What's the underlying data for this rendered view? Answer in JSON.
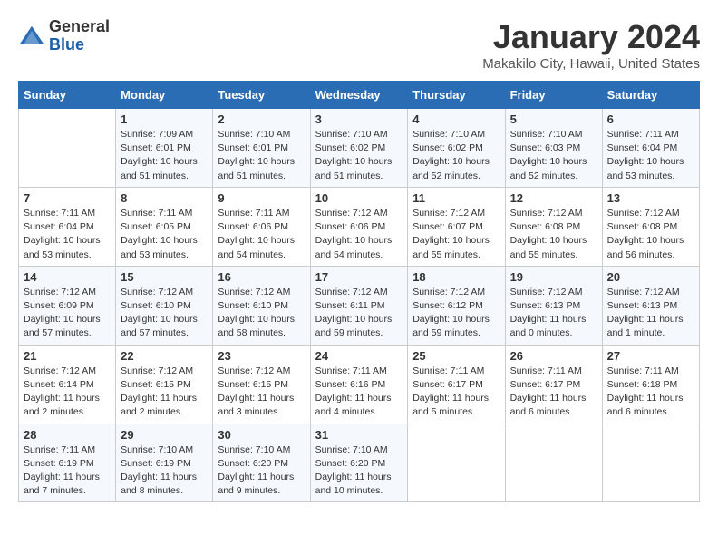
{
  "logo": {
    "general": "General",
    "blue": "Blue"
  },
  "title": "January 2024",
  "subtitle": "Makakilo City, Hawaii, United States",
  "weekdays": [
    "Sunday",
    "Monday",
    "Tuesday",
    "Wednesday",
    "Thursday",
    "Friday",
    "Saturday"
  ],
  "weeks": [
    [
      {
        "day": "",
        "sunrise": "",
        "sunset": "",
        "daylight": ""
      },
      {
        "day": "1",
        "sunrise": "Sunrise: 7:09 AM",
        "sunset": "Sunset: 6:01 PM",
        "daylight": "Daylight: 10 hours and 51 minutes."
      },
      {
        "day": "2",
        "sunrise": "Sunrise: 7:10 AM",
        "sunset": "Sunset: 6:01 PM",
        "daylight": "Daylight: 10 hours and 51 minutes."
      },
      {
        "day": "3",
        "sunrise": "Sunrise: 7:10 AM",
        "sunset": "Sunset: 6:02 PM",
        "daylight": "Daylight: 10 hours and 51 minutes."
      },
      {
        "day": "4",
        "sunrise": "Sunrise: 7:10 AM",
        "sunset": "Sunset: 6:02 PM",
        "daylight": "Daylight: 10 hours and 52 minutes."
      },
      {
        "day": "5",
        "sunrise": "Sunrise: 7:10 AM",
        "sunset": "Sunset: 6:03 PM",
        "daylight": "Daylight: 10 hours and 52 minutes."
      },
      {
        "day": "6",
        "sunrise": "Sunrise: 7:11 AM",
        "sunset": "Sunset: 6:04 PM",
        "daylight": "Daylight: 10 hours and 53 minutes."
      }
    ],
    [
      {
        "day": "7",
        "sunrise": "Sunrise: 7:11 AM",
        "sunset": "Sunset: 6:04 PM",
        "daylight": "Daylight: 10 hours and 53 minutes."
      },
      {
        "day": "8",
        "sunrise": "Sunrise: 7:11 AM",
        "sunset": "Sunset: 6:05 PM",
        "daylight": "Daylight: 10 hours and 53 minutes."
      },
      {
        "day": "9",
        "sunrise": "Sunrise: 7:11 AM",
        "sunset": "Sunset: 6:06 PM",
        "daylight": "Daylight: 10 hours and 54 minutes."
      },
      {
        "day": "10",
        "sunrise": "Sunrise: 7:12 AM",
        "sunset": "Sunset: 6:06 PM",
        "daylight": "Daylight: 10 hours and 54 minutes."
      },
      {
        "day": "11",
        "sunrise": "Sunrise: 7:12 AM",
        "sunset": "Sunset: 6:07 PM",
        "daylight": "Daylight: 10 hours and 55 minutes."
      },
      {
        "day": "12",
        "sunrise": "Sunrise: 7:12 AM",
        "sunset": "Sunset: 6:08 PM",
        "daylight": "Daylight: 10 hours and 55 minutes."
      },
      {
        "day": "13",
        "sunrise": "Sunrise: 7:12 AM",
        "sunset": "Sunset: 6:08 PM",
        "daylight": "Daylight: 10 hours and 56 minutes."
      }
    ],
    [
      {
        "day": "14",
        "sunrise": "Sunrise: 7:12 AM",
        "sunset": "Sunset: 6:09 PM",
        "daylight": "Daylight: 10 hours and 57 minutes."
      },
      {
        "day": "15",
        "sunrise": "Sunrise: 7:12 AM",
        "sunset": "Sunset: 6:10 PM",
        "daylight": "Daylight: 10 hours and 57 minutes."
      },
      {
        "day": "16",
        "sunrise": "Sunrise: 7:12 AM",
        "sunset": "Sunset: 6:10 PM",
        "daylight": "Daylight: 10 hours and 58 minutes."
      },
      {
        "day": "17",
        "sunrise": "Sunrise: 7:12 AM",
        "sunset": "Sunset: 6:11 PM",
        "daylight": "Daylight: 10 hours and 59 minutes."
      },
      {
        "day": "18",
        "sunrise": "Sunrise: 7:12 AM",
        "sunset": "Sunset: 6:12 PM",
        "daylight": "Daylight: 10 hours and 59 minutes."
      },
      {
        "day": "19",
        "sunrise": "Sunrise: 7:12 AM",
        "sunset": "Sunset: 6:13 PM",
        "daylight": "Daylight: 11 hours and 0 minutes."
      },
      {
        "day": "20",
        "sunrise": "Sunrise: 7:12 AM",
        "sunset": "Sunset: 6:13 PM",
        "daylight": "Daylight: 11 hours and 1 minute."
      }
    ],
    [
      {
        "day": "21",
        "sunrise": "Sunrise: 7:12 AM",
        "sunset": "Sunset: 6:14 PM",
        "daylight": "Daylight: 11 hours and 2 minutes."
      },
      {
        "day": "22",
        "sunrise": "Sunrise: 7:12 AM",
        "sunset": "Sunset: 6:15 PM",
        "daylight": "Daylight: 11 hours and 2 minutes."
      },
      {
        "day": "23",
        "sunrise": "Sunrise: 7:12 AM",
        "sunset": "Sunset: 6:15 PM",
        "daylight": "Daylight: 11 hours and 3 minutes."
      },
      {
        "day": "24",
        "sunrise": "Sunrise: 7:11 AM",
        "sunset": "Sunset: 6:16 PM",
        "daylight": "Daylight: 11 hours and 4 minutes."
      },
      {
        "day": "25",
        "sunrise": "Sunrise: 7:11 AM",
        "sunset": "Sunset: 6:17 PM",
        "daylight": "Daylight: 11 hours and 5 minutes."
      },
      {
        "day": "26",
        "sunrise": "Sunrise: 7:11 AM",
        "sunset": "Sunset: 6:17 PM",
        "daylight": "Daylight: 11 hours and 6 minutes."
      },
      {
        "day": "27",
        "sunrise": "Sunrise: 7:11 AM",
        "sunset": "Sunset: 6:18 PM",
        "daylight": "Daylight: 11 hours and 6 minutes."
      }
    ],
    [
      {
        "day": "28",
        "sunrise": "Sunrise: 7:11 AM",
        "sunset": "Sunset: 6:19 PM",
        "daylight": "Daylight: 11 hours and 7 minutes."
      },
      {
        "day": "29",
        "sunrise": "Sunrise: 7:10 AM",
        "sunset": "Sunset: 6:19 PM",
        "daylight": "Daylight: 11 hours and 8 minutes."
      },
      {
        "day": "30",
        "sunrise": "Sunrise: 7:10 AM",
        "sunset": "Sunset: 6:20 PM",
        "daylight": "Daylight: 11 hours and 9 minutes."
      },
      {
        "day": "31",
        "sunrise": "Sunrise: 7:10 AM",
        "sunset": "Sunset: 6:20 PM",
        "daylight": "Daylight: 11 hours and 10 minutes."
      },
      {
        "day": "",
        "sunrise": "",
        "sunset": "",
        "daylight": ""
      },
      {
        "day": "",
        "sunrise": "",
        "sunset": "",
        "daylight": ""
      },
      {
        "day": "",
        "sunrise": "",
        "sunset": "",
        "daylight": ""
      }
    ]
  ]
}
